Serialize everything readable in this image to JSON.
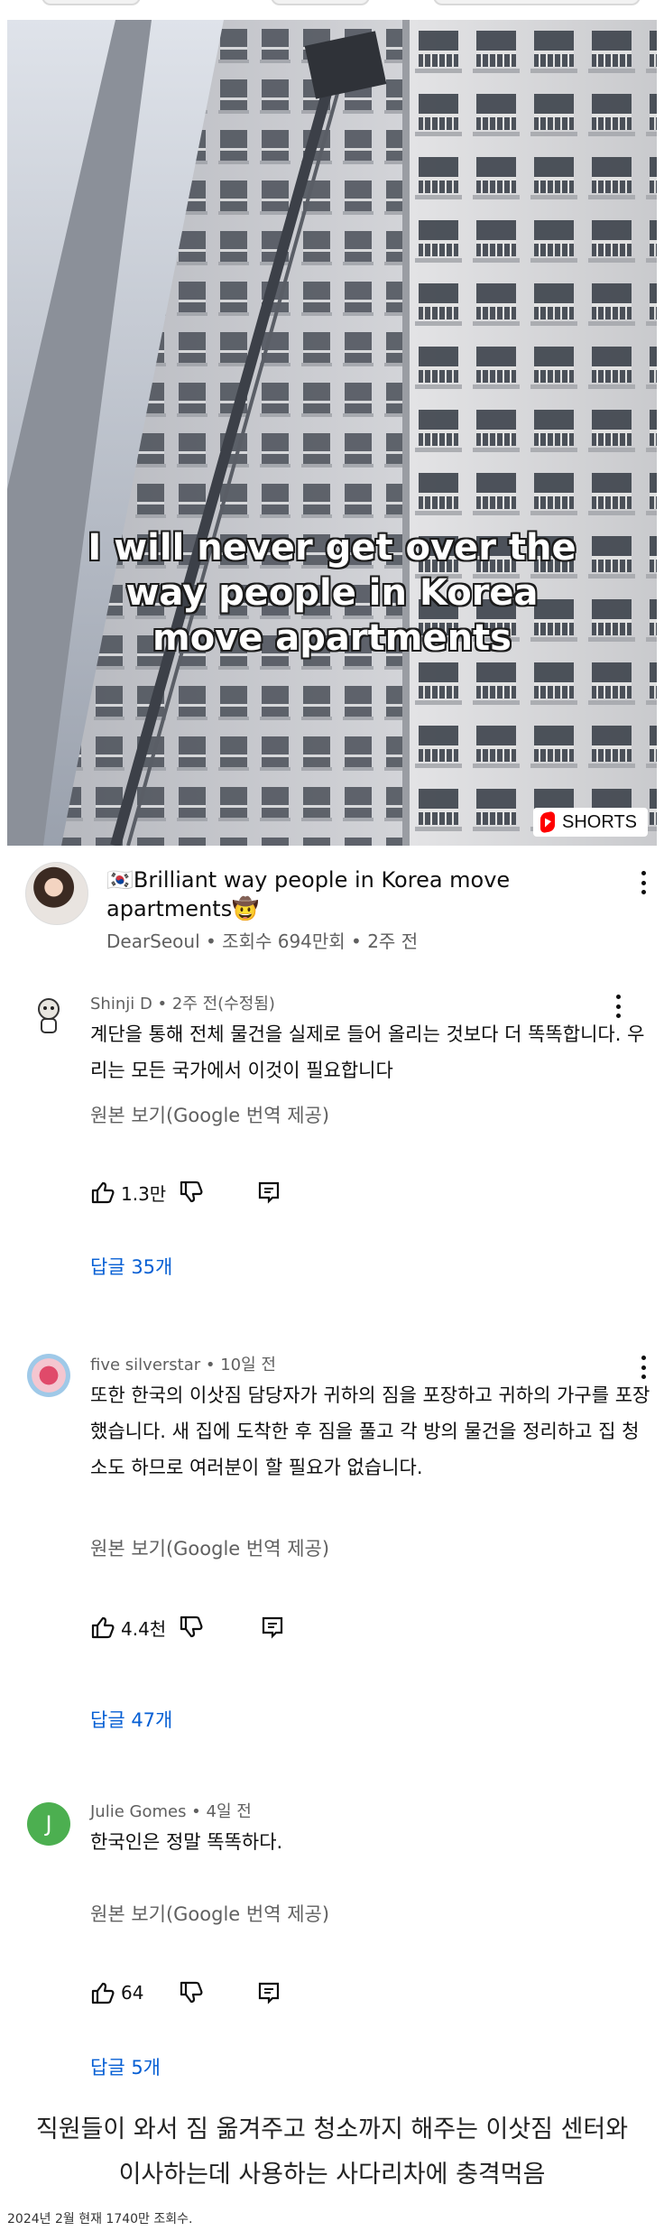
{
  "video": {
    "caption_lines": [
      "I will never get over the",
      "way people in Korea",
      "move apartments"
    ],
    "badge_label": "SHORTS",
    "badge_icon": "youtube-shorts-icon"
  },
  "channel": {
    "title": "🇰🇷Brilliant way people in Korea move apartments🤠",
    "meta": "DearSeoul • 조회수 694만회 • 2주 전"
  },
  "comments": [
    {
      "header": "Shinji D • 2주 전(수정됨)",
      "body": "계단을 통해 전체 물건을 실제로 들어 올리는 것보다 더 똑똑합니다. 우리는 모든 국가에서 이것이 필요합니다",
      "translate": "원본 보기(Google 번역 제공)",
      "likes": "1.3만",
      "replies": "답글 35개"
    },
    {
      "header": "five silverstar • 10일 전",
      "body": "또한 한국의 이삿짐 담당자가 귀하의 짐을 포장하고 귀하의 가구를 포장했습니다. 새 집에 도착한 후 짐을 풀고 각 방의 물건을 정리하고 집 청소도 하므로 여러분이 할 필요가 없습니다.",
      "translate": "원본 보기(Google 번역 제공)",
      "likes": "4.4천",
      "replies": "답글 47개"
    },
    {
      "header": "Julie Gomes • 4일 전",
      "avatar_letter": "J",
      "body": "한국인은 정말 똑똑하다.",
      "translate": "원본 보기(Google 번역 제공)",
      "likes": "64",
      "replies": "답글 5개"
    }
  ],
  "footer": {
    "lines": [
      "직원들이 와서 짐 옮겨주고 청소까지 해주는 이삿짐 센터와",
      "이사하는데 사용하는 사다리차에 충격먹음"
    ],
    "note": "2024년 2월 현재 1740만 조회수."
  },
  "colors": {
    "link": "#065fd4",
    "muted": "#606060",
    "shorts_red": "#ff0000",
    "julie_avatar": "#4caf50"
  }
}
